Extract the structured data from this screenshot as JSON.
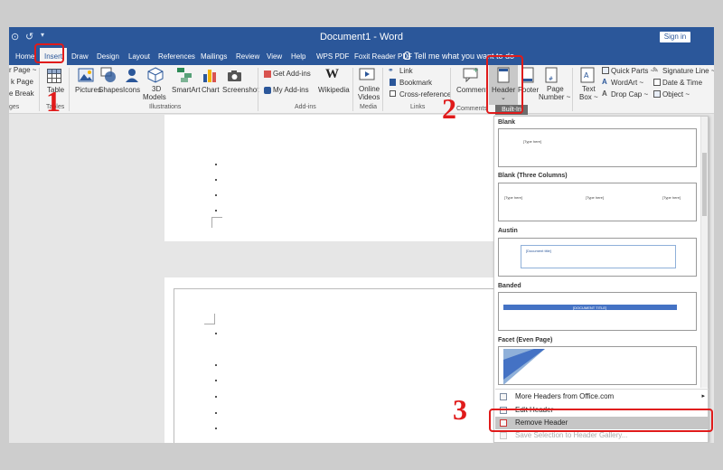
{
  "window": {
    "title": "Document1  -  Word",
    "signin_label": "Sign in",
    "accent": "#2b579a",
    "qat_symbol": "↺"
  },
  "tabs": [
    "Home",
    "Insert",
    "Draw",
    "Design",
    "Layout",
    "References",
    "Mailings",
    "Review",
    "View",
    "Help",
    "WPS PDF",
    "Foxit Reader PDF"
  ],
  "tell_me": "Tell me what you want to do",
  "ribbon": {
    "pages_group": {
      "items": [
        "r Page ~",
        "k Page",
        "e Break"
      ],
      "label": "ges"
    },
    "tables_group": {
      "table": "Table",
      "label": "Tables"
    },
    "illustrations_group": {
      "pictures": "Pictures",
      "shapes": "Shapes",
      "icons": "Icons",
      "models_line1": "3D",
      "models_line2": "Models",
      "smartart": "SmartArt",
      "chart": "Chart",
      "screenshot": "Screenshot",
      "label": "Illustrations"
    },
    "addins_group": {
      "get_addins": "Get Add-ins",
      "my_addins": "My Add-ins",
      "wikipedia": "Wikipedia",
      "label": "Add-ins"
    },
    "media_group": {
      "online": "Online",
      "videos": "Videos",
      "label": "Media"
    },
    "links_group": {
      "link": "Link",
      "bookmark": "Bookmark",
      "cross_reference": "Cross-reference",
      "label": "Links"
    },
    "comments_group": {
      "comment": "Comment",
      "label": "Comments"
    },
    "header_footer_group": {
      "header": "Header",
      "footer": "Footer",
      "page_line1": "Page",
      "page_line2": "Number ~"
    },
    "text_group": {
      "textbox_line1": "Text",
      "textbox_line2": "Box ~",
      "quick_parts": "Quick Parts ~",
      "wordart": "WordArt ~",
      "dropcap": "Drop Cap ~",
      "signature_line": "Signature Line ~",
      "date_time": "Date & Time",
      "object": "Object ~"
    }
  },
  "gallery": {
    "section_label": "Built-In",
    "items": [
      {
        "title": "Blank",
        "thumb_text": [
          "[Type here]"
        ]
      },
      {
        "title": "Blank (Three Columns)",
        "thumb_text": [
          "[Type here]",
          "[Type here]",
          "[Type here]"
        ]
      },
      {
        "title": "Austin",
        "thumb_text": [
          "[Document title]"
        ]
      },
      {
        "title": "Banded",
        "thumb_text": [
          "[DOCUMENT TITLE]"
        ]
      },
      {
        "title": "Facet (Even Page)",
        "thumb_text": []
      }
    ],
    "menu": {
      "more_headers": "More Headers from Office.com",
      "edit_header": "Edit Header",
      "remove_header": "Remove Header",
      "save_selection": "Save Selection to Header Gallery..."
    }
  },
  "annotations": {
    "step1": "1",
    "step2": "2",
    "step3": "3",
    "color": "#e01b1b"
  }
}
